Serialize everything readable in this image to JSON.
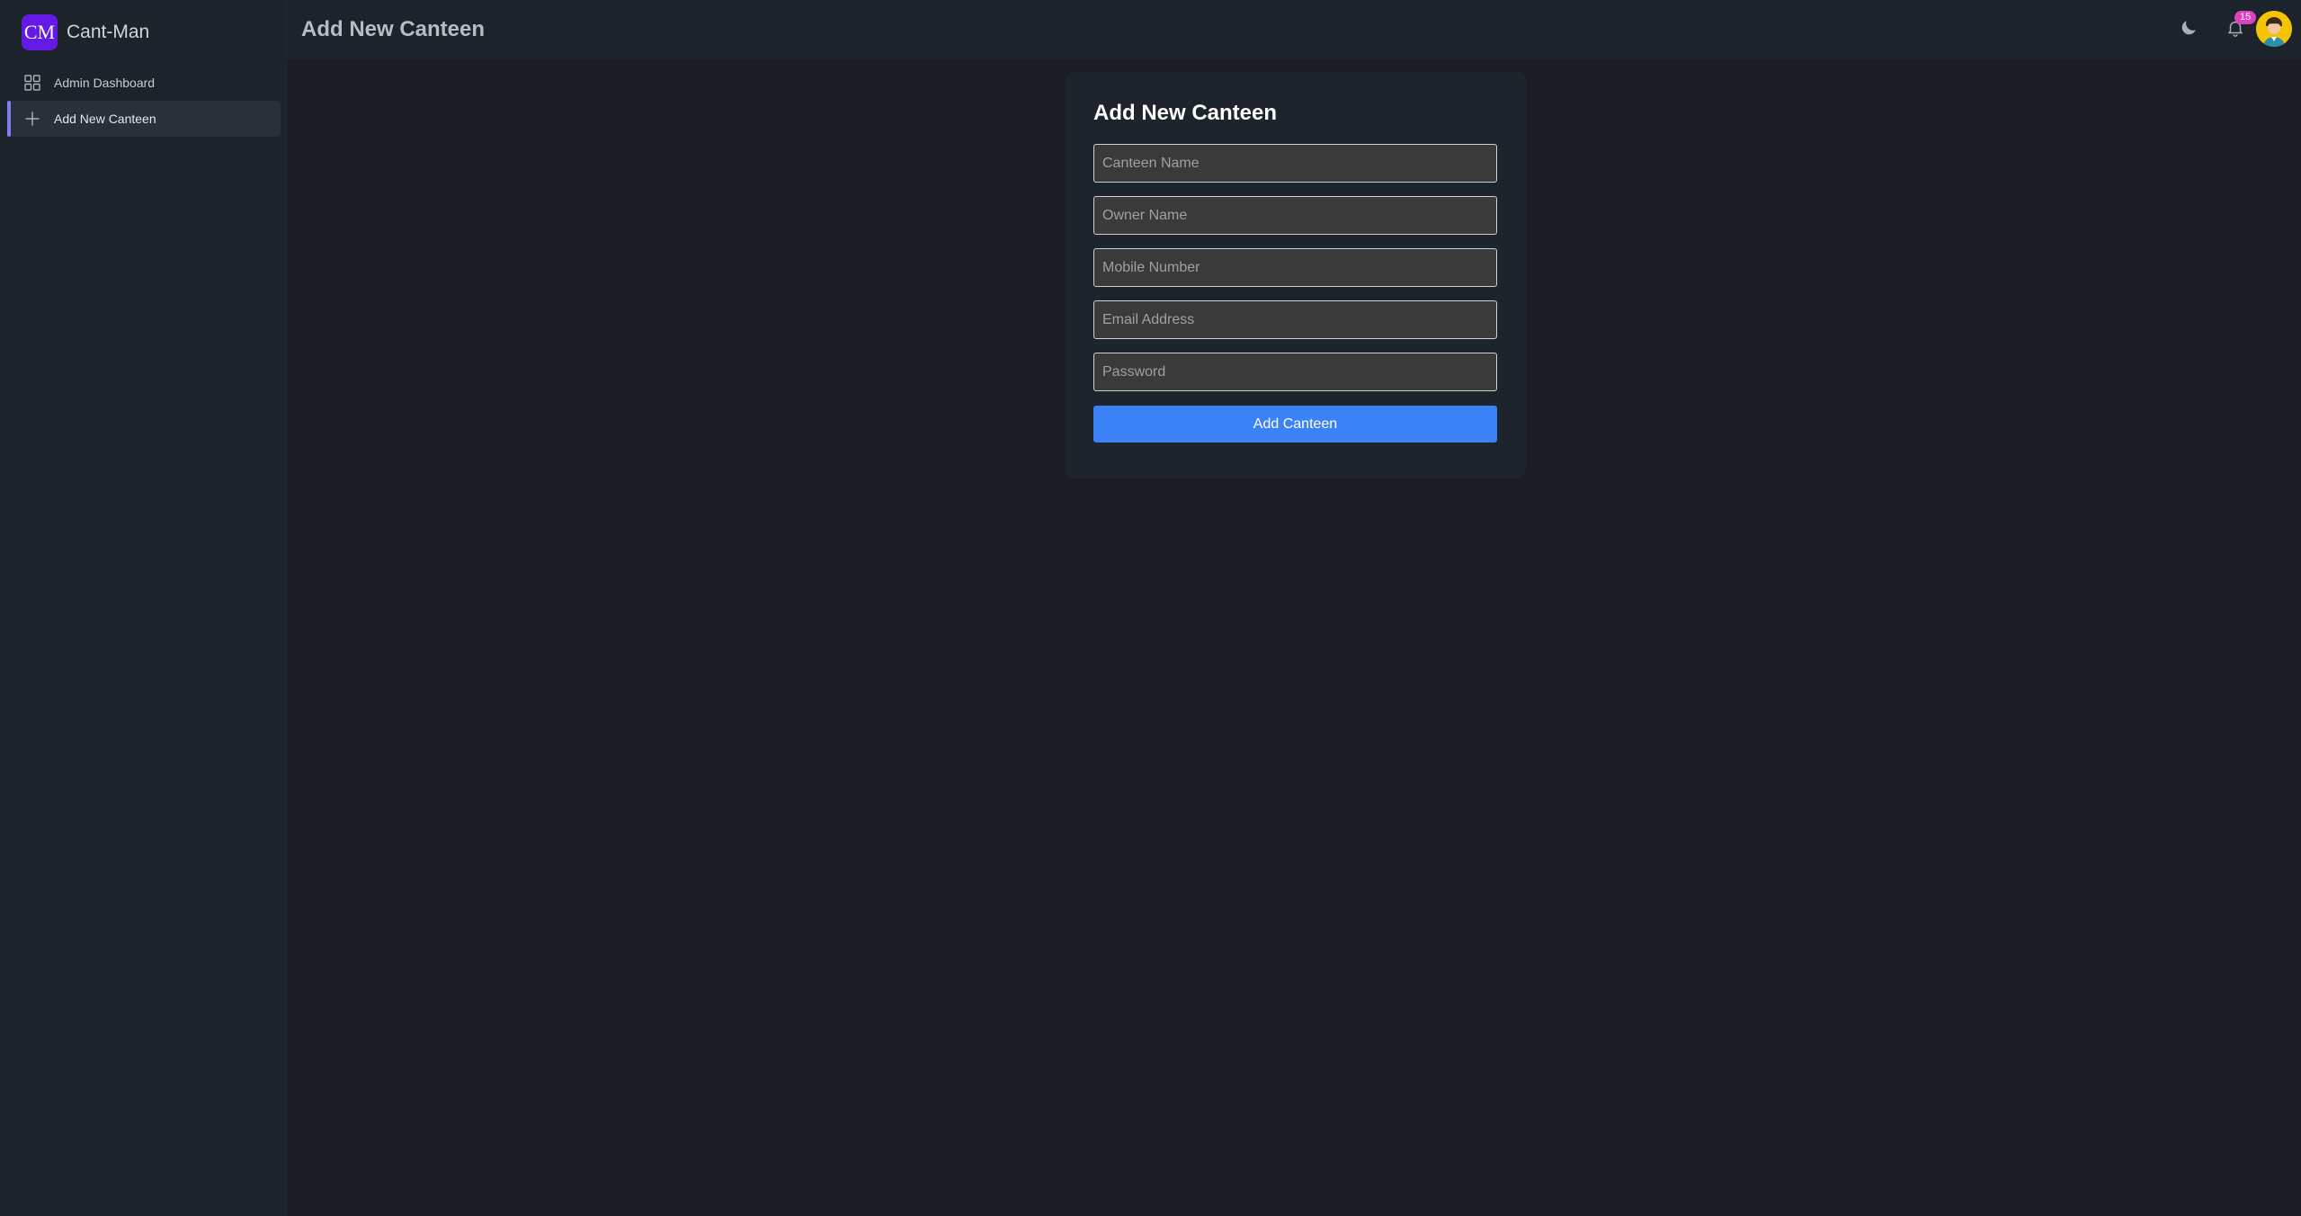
{
  "brand": {
    "logo_text": "CM",
    "name": "Cant-Man"
  },
  "sidebar": {
    "items": [
      {
        "label": "Admin Dashboard",
        "icon": "grid-icon",
        "active": false
      },
      {
        "label": "Add New Canteen",
        "icon": "plus-icon",
        "active": true
      }
    ]
  },
  "header": {
    "title": "Add New Canteen",
    "notification_count": "15",
    "icons": [
      "moon-icon",
      "bell-icon",
      "avatar"
    ]
  },
  "form": {
    "title": "Add New Canteen",
    "fields": [
      {
        "placeholder": "Canteen Name",
        "value": ""
      },
      {
        "placeholder": "Owner Name",
        "value": ""
      },
      {
        "placeholder": "Mobile Number",
        "value": ""
      },
      {
        "placeholder": "Email Address",
        "value": ""
      },
      {
        "placeholder": "Password",
        "value": ""
      }
    ],
    "submit_label": "Add Canteen"
  },
  "colors": {
    "brand_accent": "#6419e6",
    "primary_button": "#3b82f6",
    "active_indicator": "#7c7ef0",
    "badge": "#e040c0",
    "avatar_bg": "#f5c400"
  }
}
